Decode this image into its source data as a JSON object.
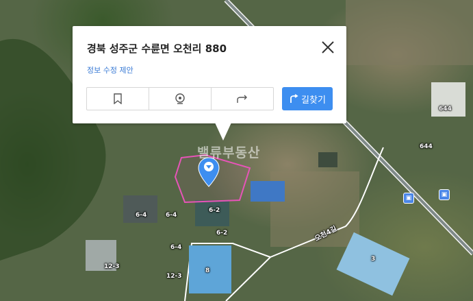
{
  "popup": {
    "address": "경북 성주군 수륜면 오천리 880",
    "edit_link": "정보 수정 제안",
    "route_button": "길찾기",
    "actions": [
      "bookmark-icon",
      "roadview-icon",
      "share-icon"
    ]
  },
  "map": {
    "watermark": "밸류부동산",
    "road_label": "오천4길",
    "lot_labels": [
      "644",
      "644",
      "6-4",
      "6-4",
      "6-4",
      "6-2",
      "6-2",
      "12-3",
      "12-3",
      "8",
      "3"
    ]
  },
  "colors": {
    "accent": "#3d8ef0",
    "parcel_outline": "#e754b8",
    "pin": "#3d8ef0"
  }
}
